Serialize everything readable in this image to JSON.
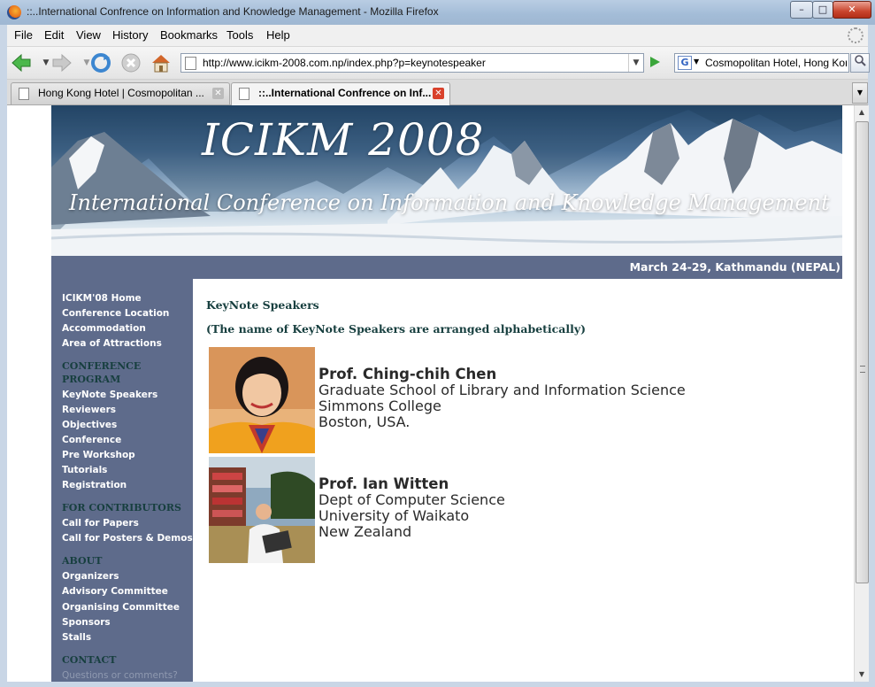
{
  "window": {
    "title": "::..International Confrence on Information and Knowledge Management - Mozilla Firefox",
    "min_glyph": "–",
    "max_glyph": "□",
    "close_glyph": "✕"
  },
  "menu": [
    "File",
    "Edit",
    "View",
    "History",
    "Bookmarks",
    "Tools",
    "Help"
  ],
  "nav": {
    "url": "http://www.icikm-2008.com.np/index.php?p=keynotespeaker",
    "search_value": "Cosmopolitan Hotel, Hong Kong",
    "search_engine_glyph": "G"
  },
  "tabs": [
    {
      "label": "Hong Kong Hotel | Cosmopolitan ...",
      "active": false
    },
    {
      "label": "::..International Confrence on Inf...",
      "active": true
    }
  ],
  "banner": {
    "title": "ICIKM 2008",
    "subtitle": "International Conference on Information and Knowledge Management",
    "date": "March 24-29, Kathmandu (NEPAL)"
  },
  "sidebar": {
    "links_top": [
      "ICIKM'08 Home",
      "Conference Location",
      "Accommodation",
      "Area of Attractions"
    ],
    "program_heading_1": "CONFERENCE",
    "program_heading_2": "PROGRAM",
    "program_links": [
      "KeyNote Speakers",
      "Reviewers",
      "Objectives",
      "Conference",
      "Pre Workshop",
      "Tutorials",
      "Registration"
    ],
    "contributors_heading": "FOR CONTRIBUTORS",
    "contributors_links": [
      "Call for Papers",
      "Call for Posters & Demos"
    ],
    "about_heading": "ABOUT",
    "about_links": [
      "Organizers",
      "Advisory Committee",
      "Organising Committee",
      "Sponsors",
      "Stalls"
    ],
    "contact_heading": "CONTACT",
    "contact_text": "Questions or comments?"
  },
  "main": {
    "heading": "KeyNote Speakers",
    "note": "(The name of KeyNote Speakers are arranged alphabetically)",
    "speakers": [
      {
        "name": "Prof. Ching-chih Chen",
        "lines": [
          "Graduate School of Library and Information Science",
          "Simmons College",
          "Boston, USA."
        ]
      },
      {
        "name": "Prof. Ian Witten",
        "lines": [
          "Dept of Computer Science",
          "University of Waikato",
          "New Zealand"
        ]
      }
    ]
  },
  "colors": {
    "sidebar_bg": "#5e6b8b",
    "heading_green": "#173f3f",
    "window_frame": "#c9d6e6"
  },
  "icons": {
    "back": "arrow-left-icon",
    "forward": "arrow-right-icon",
    "reload": "reload-icon",
    "stop": "stop-icon",
    "home": "home-icon",
    "go": "go-arrow-icon",
    "search": "magnifier-icon"
  }
}
